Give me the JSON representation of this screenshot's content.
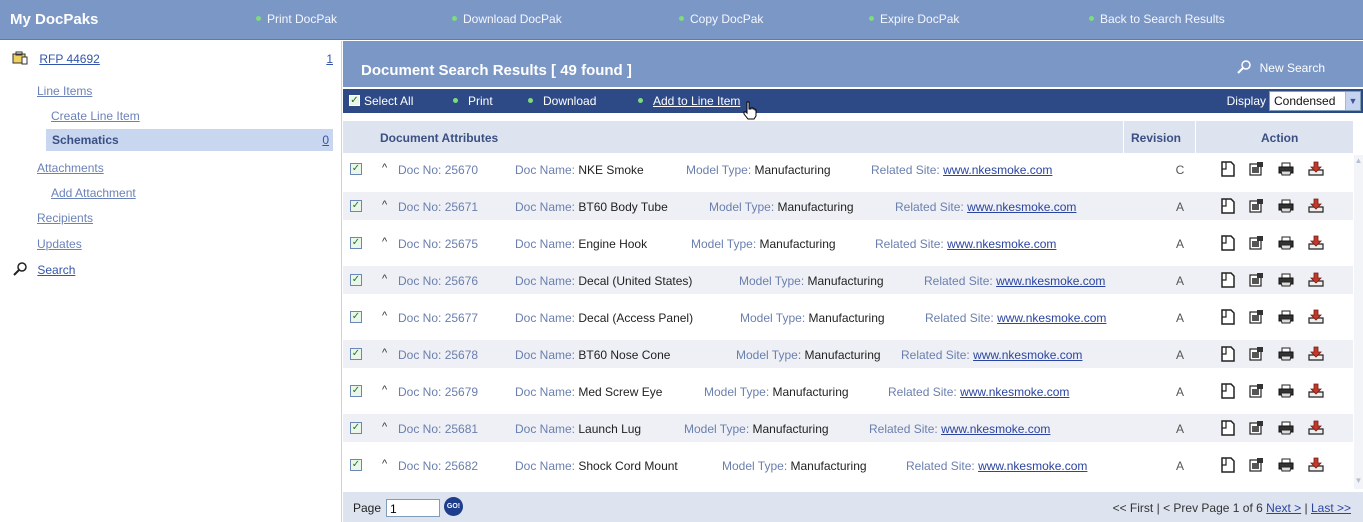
{
  "app": {
    "title": "My DocPaks"
  },
  "top_nav": [
    {
      "label": "Print DocPak"
    },
    {
      "label": "Download DocPak"
    },
    {
      "label": "Copy DocPak"
    },
    {
      "label": "Expire DocPak"
    },
    {
      "label": "Back to Search Results"
    }
  ],
  "sidebar": {
    "rfp": {
      "label": "RFP 44692",
      "count": "1"
    },
    "line_items": "Line Items",
    "create_line_item": "Create Line Item",
    "selected": {
      "label": "Schematics",
      "count": "0"
    },
    "attachments": "Attachments",
    "add_attachment": "Add Attachment",
    "recipients": "Recipients",
    "updates": "Updates",
    "search": "Search"
  },
  "results": {
    "title": "Document Search Results [ 49 found ]",
    "new_search": "New Search"
  },
  "action_bar": {
    "select_all": "Select All",
    "print": "Print",
    "download": "Download",
    "add_to_line_item": "Add to Line Item",
    "display_label": "Display",
    "display_value": "Condensed"
  },
  "columns": {
    "attributes": "Document Attributes",
    "revision": "Revision",
    "action": "Action"
  },
  "field_labels": {
    "doc_no": "Doc No:",
    "doc_name": "Doc Name:",
    "model_type": "Model Type:",
    "related_site": "Related Site:"
  },
  "rows": [
    {
      "doc_no": "25670",
      "doc_name": "NKE Smoke",
      "model_type": "Manufacturing",
      "site": "www.nkesmoke.com",
      "revision": "C"
    },
    {
      "doc_no": "25671",
      "doc_name": "BT60 Body Tube",
      "model_type": "Manufacturing",
      "site": "www.nkesmoke.com",
      "revision": "A"
    },
    {
      "doc_no": "25675",
      "doc_name": "Engine Hook",
      "model_type": "Manufacturing",
      "site": "www.nkesmoke.com",
      "revision": "A"
    },
    {
      "doc_no": "25676",
      "doc_name": "Decal (United States)",
      "model_type": "Manufacturing",
      "site": "www.nkesmoke.com",
      "revision": "A"
    },
    {
      "doc_no": "25677",
      "doc_name": "Decal (Access Panel)",
      "model_type": "Manufacturing",
      "site": "www.nkesmoke.com",
      "revision": "A"
    },
    {
      "doc_no": "25678",
      "doc_name": "BT60 Nose Cone",
      "model_type": "Manufacturing",
      "site": "www.nkesmoke.com",
      "revision": "A"
    },
    {
      "doc_no": "25679",
      "doc_name": "Med Screw Eye",
      "model_type": "Manufacturing",
      "site": "www.nkesmoke.com",
      "revision": "A"
    },
    {
      "doc_no": "25681",
      "doc_name": "Launch Lug",
      "model_type": "Manufacturing",
      "site": "www.nkesmoke.com",
      "revision": "A"
    },
    {
      "doc_no": "25682",
      "doc_name": "Shock Cord Mount",
      "model_type": "Manufacturing",
      "site": "www.nkesmoke.com",
      "revision": "A"
    }
  ],
  "pager": {
    "page_label": "Page",
    "page_value": "1",
    "go": "GO!",
    "first": "<< First",
    "prev": "< Prev",
    "status": "Page 1 of 6",
    "next": "Next >",
    "last": "Last >>"
  }
}
